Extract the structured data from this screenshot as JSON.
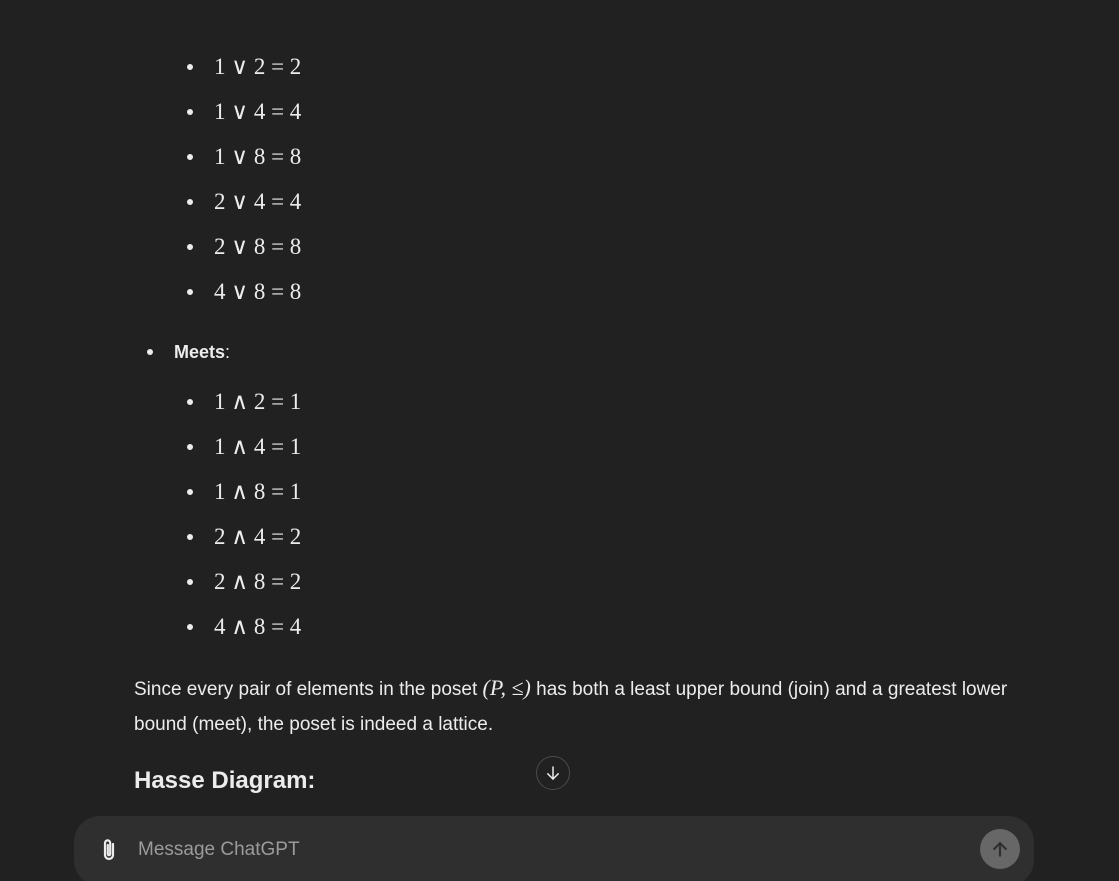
{
  "joins": {
    "items": [
      "1 ∨ 2 = 2",
      "1 ∨ 4 = 4",
      "1 ∨ 8 = 8",
      "2 ∨ 4 = 4",
      "2 ∨ 8 = 8",
      "4 ∨ 8 = 8"
    ]
  },
  "meets": {
    "label": "Meets",
    "colon": ":",
    "items": [
      "1 ∧ 2 = 1",
      "1 ∧ 4 = 1",
      "1 ∧ 8 = 1",
      "2 ∧ 4 = 2",
      "2 ∧ 8 = 2",
      "4 ∧ 8 = 4"
    ]
  },
  "conclusion": {
    "before": "Since every pair of elements in the poset ",
    "math": "(P, ≤)",
    "after": " has both a least upper bound (join) and a greatest lower bound (meet), the poset is indeed a lattice."
  },
  "next_heading": "Hasse Diagram:",
  "composer": {
    "placeholder": "Message ChatGPT",
    "attach_icon": "paperclip-icon",
    "send_icon": "arrow-up-icon"
  },
  "scroll_button_icon": "arrow-down-icon"
}
